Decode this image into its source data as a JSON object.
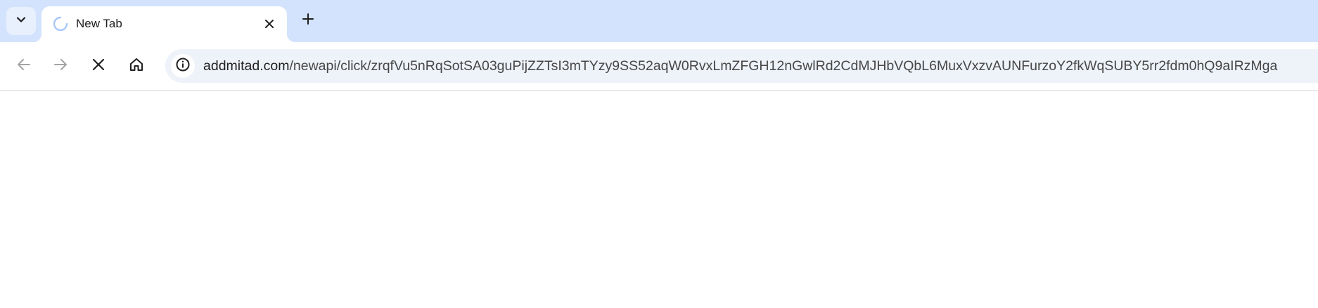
{
  "tab_strip": {
    "tab_search_icon": "chevron-down-icon",
    "active_tab": {
      "title": "New Tab",
      "loading_icon": "loading-spinner-icon",
      "close_icon": "close-icon"
    },
    "new_tab_icon": "plus-icon"
  },
  "toolbar": {
    "back_icon": "back-arrow-icon",
    "forward_icon": "forward-arrow-icon",
    "stop_icon": "stop-loading-icon",
    "home_icon": "home-icon",
    "site_info_icon": "info-icon",
    "url_host": "addmitad.com",
    "url_path": "/newapi/click/zrqfVu5nRqSotSA03guPijZZTsI3mTYzy9SS52aqW0RvxLmZFGH12nGwlRd2CdMJHbVQbL6MuxVxzvAUNFurzoY2fkWqSUBY5rr2fdm0hQ9aIRzMga"
  },
  "colors": {
    "tab_strip_bg": "#d3e3fd",
    "omnibox_bg": "#eef2f9",
    "spinner": "#a8c7fa"
  }
}
